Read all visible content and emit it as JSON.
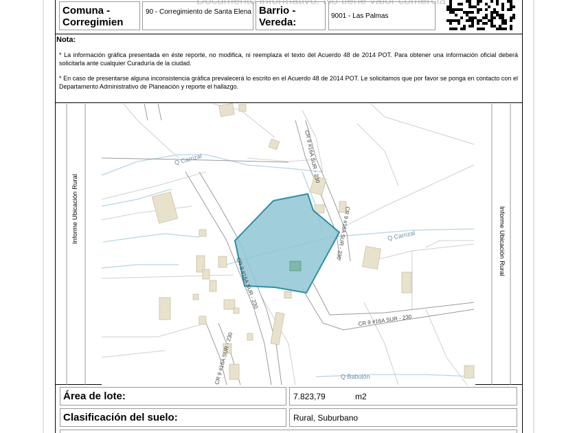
{
  "header": {
    "comuna_label": "Comuna -\nCorregimien",
    "comuna_value": "90 - Corregimiento de Santa Elena",
    "barrio_label": "Barrio -\nVereda:",
    "barrio_value": "9001 - Las Palmas",
    "watermark": "Documento informativo. No tiene valor comercial."
  },
  "nota": {
    "title": "Nota:",
    "p1": "* La información gráfica presentada en éste reporte, no  modifica, ni reemplaza el texto del Acuerdo 48 de 2014 POT. Para obtener una información oficial deberá solicitarla ante cualquier Curaduría de la ciudad.",
    "p2": "* En caso de presentarse alguna inconsistencia gráfica  prevalecerá lo escrito en el Acuerdo 48 de 2014 POT. Le solicitamos que por favor se ponga en contacto  con el Departamento Administrativo de Planeación y reporte el hallazgo."
  },
  "map": {
    "side_label": "Informe Ubicación Rural",
    "labels": {
      "q_carrizal_1": "Q  Carrizal",
      "q_carrizal_2": "Q  Carrizal",
      "q_babulon": "Q  Babulón",
      "road_top": "CR 9 #16A SUR - 230",
      "road_right": "CR 9 #16A SUR - 230",
      "road_center": "CR 9 #16A SUR - 230",
      "road_bottom": "CR 9 #16A SUR - 230",
      "road_east": "CR 9 #16A SUR - 230"
    },
    "parcel_color": "#8fc6d3",
    "parcel_stroke": "#2a8fa8"
  },
  "footer": {
    "area_label": "Área de lote:",
    "area_value": "7.823,79",
    "area_unit": "m2",
    "clasificacion_label": "Clasificación del suelo:",
    "clasificacion_value": "Rural, Suburbano"
  }
}
